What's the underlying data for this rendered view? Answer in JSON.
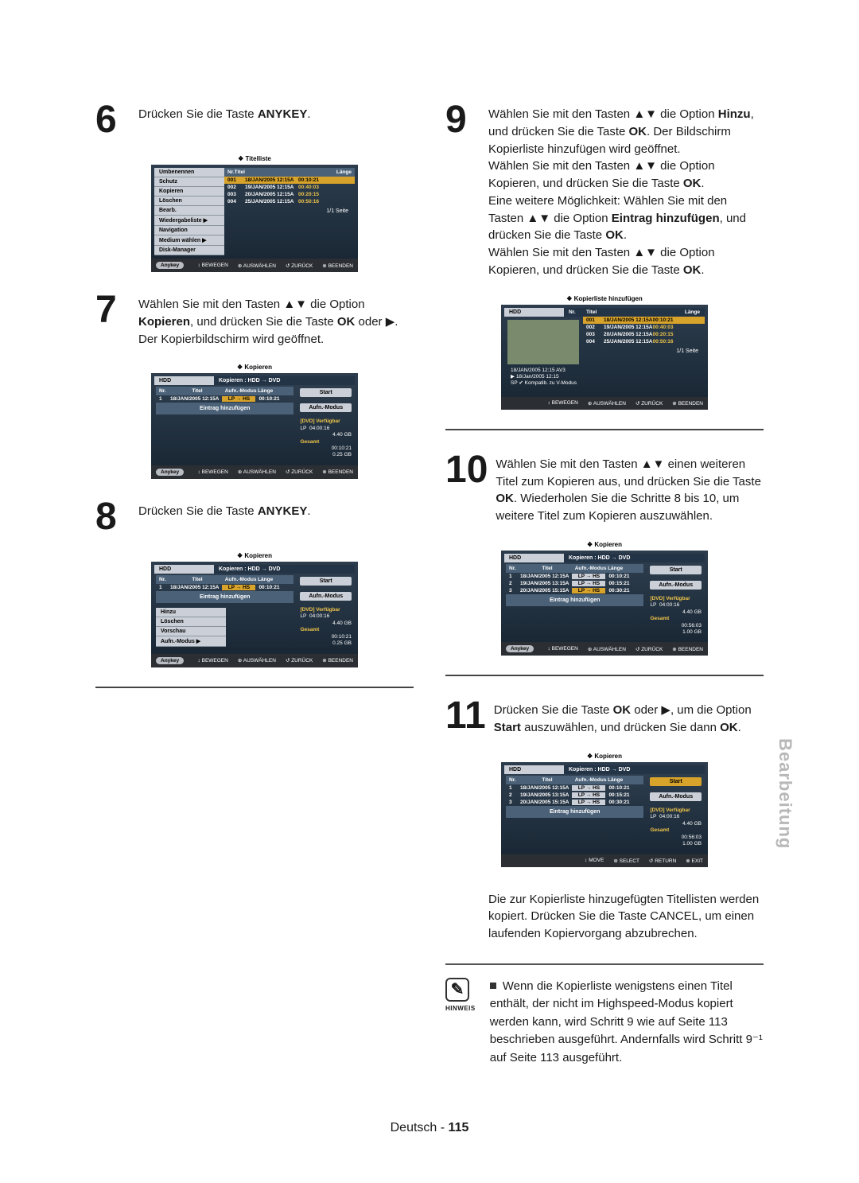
{
  "sidetab": "Bearbeitung",
  "page_footer": {
    "label": "Deutsch -",
    "num": "115"
  },
  "note": {
    "label": "HINWEIS",
    "body": "Wenn die Kopierliste wenigstens einen Titel enthält, der nicht im Highspeed-Modus kopiert werden kann, wird Schritt 9 wie auf Seite 113 beschrieben ausgeführt. Andernfalls wird Schritt 9⁻¹ auf Seite 113 ausgeführt."
  },
  "step6": {
    "num": "6",
    "text": "Drücken Sie die Taste ",
    "key": "ANYKEY",
    "suffix": "."
  },
  "step7": {
    "num": "7",
    "text_a": "Wählen Sie mit den Tasten ▲▼ die Option ",
    "bold": "Kopieren",
    "text_b": ", und drücken Sie die Taste ",
    "bold2": "OK",
    "text_c": " oder ▶. Der Kopierbildschirm wird geöffnet."
  },
  "step8": {
    "num": "8",
    "text": "Drücken Sie die Taste ",
    "key": "ANYKEY",
    "suffix": "."
  },
  "step9": {
    "num": "9",
    "lines": [
      "Wählen Sie mit den Tasten ▲▼ die Option ",
      ", und drücken Sie die Taste ",
      ". Der Bildschirm Kopierliste hinzufügen wird geöffnet.",
      "Wählen Sie mit den Tasten ▲▼ die Option Kopieren, und drücken Sie die Taste ",
      ".",
      "Eine weitere Möglichkeit: Wählen Sie mit den Tasten ▲▼ die Option ",
      ", und drücken Sie die Taste ",
      ".",
      "Wählen Sie mit den Tasten ▲▼ die Option Kopieren, und drücken Sie die Taste ",
      "."
    ],
    "b_hinzu": "Hinzu",
    "b_ok": "OK",
    "b_eintrag": "Eintrag hinzufügen"
  },
  "step10": {
    "num": "10",
    "text_a": "Wählen Sie mit den Tasten ▲▼ einen weiteren Titel zum Kopieren aus, und drücken Sie die Taste ",
    "bold": "OK",
    "text_b": ". Wiederholen Sie die Schritte 8 bis 10, um weitere Titel zum Kopieren auszuwählen."
  },
  "step11": {
    "num": "11",
    "text_a": "Drücken Sie die Taste ",
    "bold": "OK",
    "text_b": " oder ▶, um die Option ",
    "bold2": "Start",
    "text_c": " auszuwählen, und drücken Sie dann ",
    "bold3": "OK",
    "text_d": ".",
    "trailer": "Die zur Kopierliste hinzugefügten Titellisten werden kopiert. Drücken Sie die Taste CANCEL, um einen laufenden Kopiervorgang abzubrechen.",
    "trailer_b": "CANCEL"
  },
  "scr_titelliste": {
    "title": "❖  Titelliste",
    "menu": [
      "Umbenennen",
      "Schutz",
      "Kopieren",
      "Löschen",
      "Bearb.",
      "Wiedergabeliste",
      "Navigation",
      "Medium wählen",
      "Disk-Manager"
    ],
    "heads": {
      "nr": "Nr.",
      "titel": "Titel",
      "laenge": "Länge"
    },
    "rows": [
      {
        "n": "001",
        "t": "18/JAN/2005 12:15A",
        "l": "00:10:21"
      },
      {
        "n": "002",
        "t": "19/JAN/2005 12:15A",
        "l": "00:40:03"
      },
      {
        "n": "003",
        "t": "20/JAN/2005 12:15A",
        "l": "00:20:15"
      },
      {
        "n": "004",
        "t": "25/JAN/2005 12:15A",
        "l": "00:50:16"
      }
    ],
    "pager": "1/1 Seite",
    "footer": {
      "anykey": "Anykey",
      "move": "BEWEGEN",
      "select": "AUSWÄHLEN",
      "back": "ZURÜCK",
      "exit": "BEENDEN"
    }
  },
  "scr_kopieren1": {
    "title": "❖  Kopieren",
    "hdd": "HDD",
    "path": "Kopieren : HDD → DVD",
    "heads": {
      "nr": "Nr.",
      "titel": "Titel",
      "aufn": "Aufn.-Modus",
      "laenge": "Länge"
    },
    "row": {
      "n": "1",
      "t": "18/JAN/2005 12:15A",
      "m": "LP → HS",
      "l": "00:10:21"
    },
    "add": "Eintrag hinzufügen",
    "rbtn": {
      "start": "Start",
      "aufn": "Aufn.-Modus"
    },
    "info": {
      "avail_lbl": "[DVD] Verfügbar",
      "lp": "LP",
      "lp_time": "04:00:16",
      "size": "4.40 GB",
      "ges": "Gesamt",
      "ges_time": "00:10:21",
      "ges_size": "0.25 GB"
    },
    "footer": {
      "anykey": "Anykey",
      "move": "BEWEGEN",
      "select": "AUSWÄHLEN",
      "back": "ZURÜCK",
      "exit": "BEENDEN"
    }
  },
  "scr_kopieren2": {
    "title": "❖  Kopieren",
    "menu": [
      "Hinzu",
      "Löschen",
      "Vorschau",
      "Aufn.-Modus"
    ],
    "hdd": "HDD",
    "path": "Kopieren : HDD → DVD",
    "heads": {
      "nr": "Nr.",
      "titel": "Titel",
      "aufn": "Aufn.-Modus",
      "laenge": "Länge"
    },
    "row": {
      "n": "1",
      "t": "18/JAN/2005 12:15A",
      "m": "LP → HS",
      "l": "00:10:21"
    },
    "add": "Eintrag hinzufügen",
    "rbtn": {
      "start": "Start",
      "aufn": "Aufn.-Modus"
    },
    "info": {
      "avail_lbl": "[DVD] Verfügbar",
      "lp": "LP",
      "lp_time": "04:00:16",
      "size": "4.40 GB",
      "ges": "Gesamt",
      "ges_time": "00:10:21",
      "ges_size": "0.25 GB"
    },
    "footer": {
      "anykey": "Anykey",
      "move": "BEWEGEN",
      "select": "AUSWÄHLEN",
      "back": "ZURÜCK",
      "exit": "BEENDEN"
    }
  },
  "scr_klist": {
    "title": "❖  Kopierliste hinzufügen",
    "hdd": "HDD",
    "heads": {
      "nr": "Nr.",
      "titel": "Titel",
      "laenge": "Länge"
    },
    "rows": [
      {
        "n": "001",
        "t": "18/JAN/2005 12:15A",
        "l": "00:10:21"
      },
      {
        "n": "002",
        "t": "19/JAN/2005 12:15A",
        "l": "00:40:03"
      },
      {
        "n": "003",
        "t": "20/JAN/2005 12:15A",
        "l": "00:20:15"
      },
      {
        "n": "004",
        "t": "25/JAN/2005 12:15A",
        "l": "00:50:16"
      }
    ],
    "sub1": "18/JAN/2005 12:15 AV3",
    "sub2": "18/Jan/2005 12:15",
    "sub3": "SP ✔ Kompatib. zu V-Modus",
    "pager": "1/1 Seite",
    "footer": {
      "move": "BEWEGEN",
      "select": "AUSWÄHLEN",
      "back": "ZURÜCK",
      "exit": "BEENDEN"
    }
  },
  "scr_kopieren3": {
    "title": "❖  Kopieren",
    "hdd": "HDD",
    "path": "Kopieren : HDD → DVD",
    "heads": {
      "nr": "Nr.",
      "titel": "Titel",
      "aufn": "Aufn.-Modus",
      "laenge": "Länge"
    },
    "rows": [
      {
        "n": "1",
        "t": "18/JAN/2005 12:15A",
        "m": "LP → HS",
        "l": "00:10:21"
      },
      {
        "n": "2",
        "t": "19/JAN/2005 13:15A",
        "m": "LP → HS",
        "l": "00:15:21"
      },
      {
        "n": "3",
        "t": "20/JAN/2005 15:15A",
        "m": "LP → HS",
        "l": "00:30:21"
      }
    ],
    "add": "Eintrag hinzufügen",
    "rbtn": {
      "start": "Start",
      "aufn": "Aufn.-Modus"
    },
    "info": {
      "avail_lbl": "[DVD] Verfügbar",
      "lp": "LP",
      "lp_time": "04:00:16",
      "size": "4.40 GB",
      "ges": "Gesamt",
      "ges_time": "00:56:03",
      "ges_size": "1.00 GB"
    },
    "footer": {
      "anykey": "Anykey",
      "move": "BEWEGEN",
      "select": "AUSWÄHLEN",
      "back": "ZURÜCK",
      "exit": "BEENDEN"
    }
  },
  "scr_kopieren4": {
    "title": "❖  Kopieren",
    "hdd": "HDD",
    "path": "Kopieren : HDD → DVD",
    "heads": {
      "nr": "Nr.",
      "titel": "Titel",
      "aufn": "Aufn.-Modus",
      "laenge": "Länge"
    },
    "rows": [
      {
        "n": "1",
        "t": "18/JAN/2005 12:15A",
        "m": "LP → HS",
        "l": "00:10:21"
      },
      {
        "n": "2",
        "t": "19/JAN/2005 13:15A",
        "m": "LP → HS",
        "l": "00:15:21"
      },
      {
        "n": "3",
        "t": "20/JAN/2005 15:15A",
        "m": "LP → HS",
        "l": "00:30:21"
      }
    ],
    "add": "Eintrag hinzufügen",
    "rbtn": {
      "start": "Start",
      "aufn": "Aufn.-Modus"
    },
    "info": {
      "avail_lbl": "[DVD] Verfügbar",
      "lp": "LP",
      "lp_time": "04:00:16",
      "size": "4.40 GB",
      "ges": "Gesamt",
      "ges_time": "00:56:03",
      "ges_size": "1.00 GB"
    },
    "footer": {
      "move": "MOVE",
      "select": "SELECT",
      "back": "RETURN",
      "exit": "EXIT"
    }
  }
}
